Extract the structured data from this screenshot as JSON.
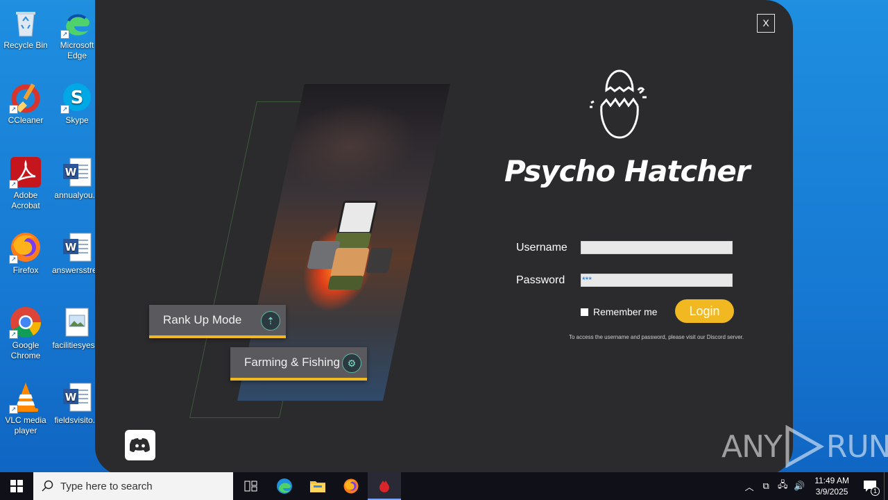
{
  "desktop": {
    "icons": [
      {
        "label": "Recycle Bin",
        "icon": "recycle-bin-icon"
      },
      {
        "label": "Microsoft Edge",
        "icon": "edge-icon"
      },
      {
        "label": "CCleaner",
        "icon": "ccleaner-icon"
      },
      {
        "label": "Skype",
        "icon": "skype-icon"
      },
      {
        "label": "Adobe Acrobat",
        "icon": "acrobat-icon"
      },
      {
        "label": "annualyou...",
        "icon": "word-doc-icon"
      },
      {
        "label": "Firefox",
        "icon": "firefox-icon"
      },
      {
        "label": "answersstre...",
        "icon": "word-doc-icon"
      },
      {
        "label": "Google Chrome",
        "icon": "chrome-icon"
      },
      {
        "label": "facilitiesyes...",
        "icon": "image-file-icon"
      },
      {
        "label": "VLC media player",
        "icon": "vlc-icon"
      },
      {
        "label": "fieldsvisito...",
        "icon": "word-doc-icon"
      }
    ]
  },
  "app": {
    "close_label": "X",
    "title": "Psycho Hatcher",
    "modes": [
      {
        "label": "Rank Up Mode",
        "icon": "rank-up-icon"
      },
      {
        "label": "Farming & Fishing",
        "icon": "farming-icon"
      }
    ],
    "form": {
      "username_label": "Username",
      "username_value": "",
      "password_label": "Password",
      "password_value": "***",
      "remember_label": "Remember me",
      "remember_checked": false,
      "login_label": "Login",
      "hint": "To access the username and password, please visit our Discord server."
    },
    "discord_icon": "discord-icon",
    "accent_color": "#f2b821",
    "background_color": "#2b2b2e"
  },
  "watermark": {
    "text_left": "ANY",
    "text_right": "RUN"
  },
  "taskbar": {
    "search_placeholder": "Type here to search",
    "apps": [
      "task-view-icon",
      "edge-icon",
      "file-explorer-icon",
      "firefox-icon",
      "psycho-hatcher-icon"
    ],
    "clock_time": "11:49 AM",
    "clock_date": "3/9/2025",
    "notification_count": "1"
  }
}
